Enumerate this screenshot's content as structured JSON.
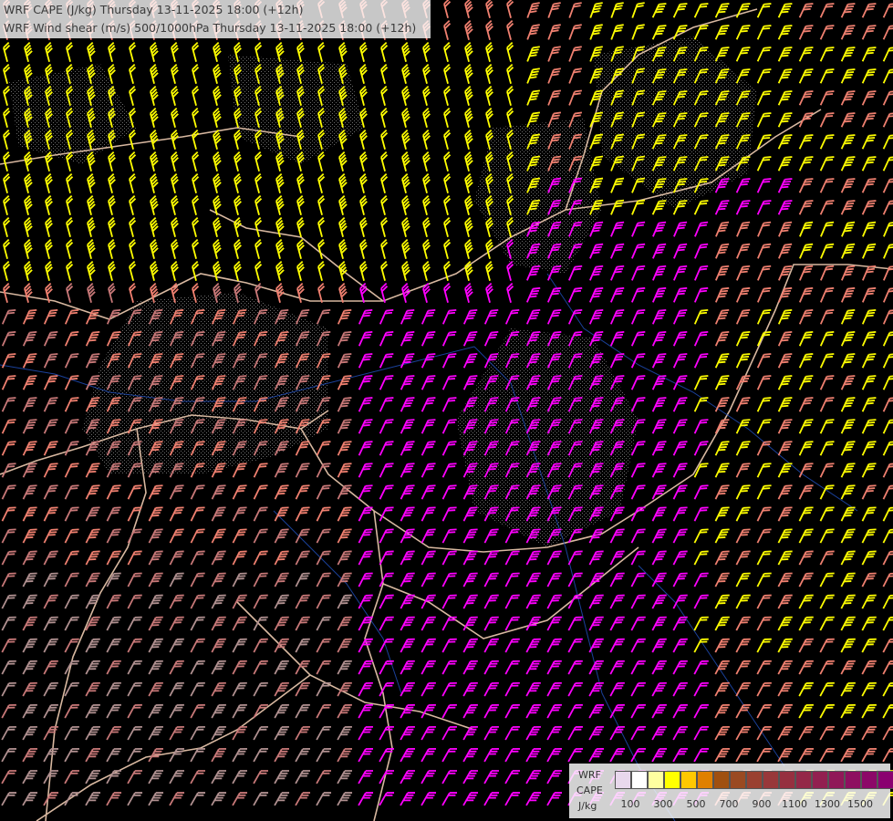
{
  "title": {
    "line1": "WRF CAPE (J/kg) Thursday 13-11-2025 18:00 (+12h)",
    "line2": "WRF Wind shear (m/s) 500/1000hPa Thursday 13-11-2025 18:00 (+12h)"
  },
  "legend": {
    "label_model": "WRF",
    "label_field": "CAPE",
    "label_unit": "J/kg",
    "swatch_colors": [
      "#e8d8ec",
      "#ffffff",
      "#ffffa0",
      "#ffff00",
      "#ffc800",
      "#e08000",
      "#a05010",
      "#9a4a22",
      "#9a4030",
      "#98383a",
      "#963040",
      "#942848",
      "#922050",
      "#901858",
      "#8e1060",
      "#8c0868",
      "#8a0070"
    ],
    "tick_labels": [
      "100",
      "300",
      "500",
      "700",
      "900",
      "1100",
      "1300",
      "1500"
    ]
  },
  "colors": {
    "barb_yellow": "#ffff00",
    "barb_magenta": "#ff00ff",
    "barb_salmon": "#f08070",
    "barb_pink": "#c87878",
    "barb_gray": "#b09090",
    "border_line": "#d8b8a0",
    "river_line": "#2050c0",
    "background": "#000000"
  }
}
